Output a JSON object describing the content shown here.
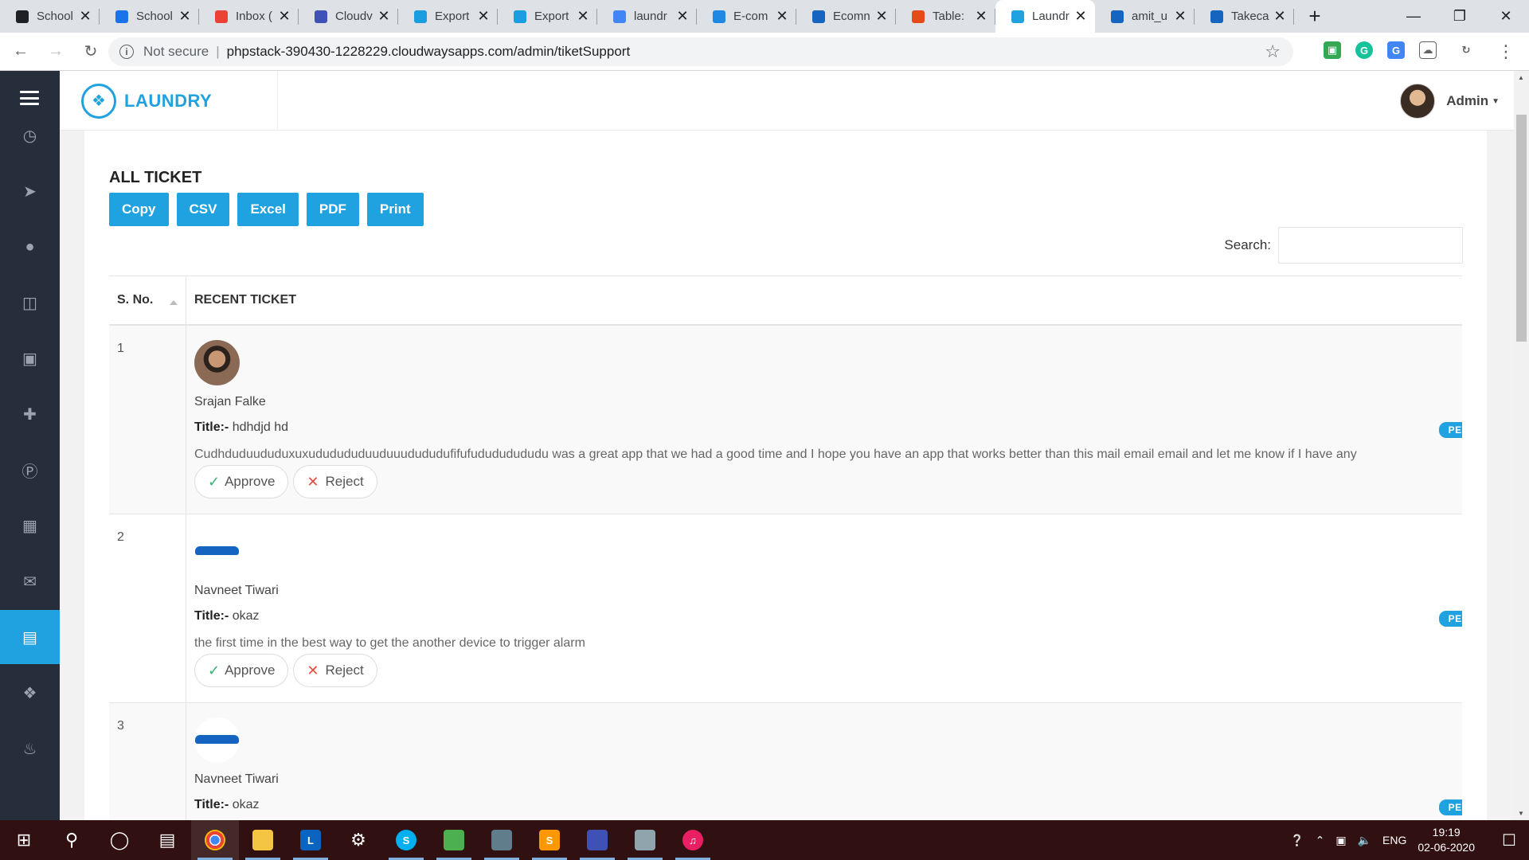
{
  "browser": {
    "tabs": [
      {
        "label": "School",
        "icon_color": "#202124",
        "active": false
      },
      {
        "label": "School",
        "icon_color": "#1a73e8",
        "active": false
      },
      {
        "label": "Inbox (",
        "icon_color": "#ea4335",
        "active": false
      },
      {
        "label": "Cloudv",
        "icon_color": "#3f51b5",
        "active": false
      },
      {
        "label": "Export",
        "icon_color": "#1a9ee0",
        "active": false
      },
      {
        "label": "Export",
        "icon_color": "#1a9ee0",
        "active": false
      },
      {
        "label": "laundr",
        "icon_color": "#4285f4",
        "active": false
      },
      {
        "label": "E-com",
        "icon_color": "#1e88e5",
        "active": false
      },
      {
        "label": "Ecomn",
        "icon_color": "#1565c0",
        "active": false
      },
      {
        "label": "Table:",
        "icon_color": "#e64a19",
        "active": false
      },
      {
        "label": "Laundr",
        "icon_color": "#1fa2df",
        "active": true
      },
      {
        "label": "amit_u",
        "icon_color": "#1565c0",
        "active": false
      },
      {
        "label": "Takeca",
        "icon_color": "#1565c0",
        "active": false
      }
    ],
    "new_tab_symbol": "+",
    "close_symbol": "✕",
    "security_label": "Not secure",
    "url": "phpstack-390430-1228229.cloudwaysapps.com/admin/tiketSupport"
  },
  "app": {
    "brand": "LAUNDRY",
    "user_name": "Admin",
    "accent_color": "#1fa2df",
    "sidebar_icons": [
      "dashboard-icon",
      "send-icon",
      "user-icon",
      "columns-icon",
      "ad-icon",
      "user-plus-icon",
      "parking-icon",
      "gift-icon",
      "ticket-icon",
      "document-icon",
      "cart-icon",
      "bell-icon"
    ],
    "sidebar_active_index": 9
  },
  "page": {
    "title": "ALL TICKET",
    "export_buttons": [
      "Copy",
      "CSV",
      "Excel",
      "PDF",
      "Print"
    ],
    "search_label": "Search:",
    "search_value": "",
    "columns": [
      "S. No.",
      "RECENT TICKET"
    ],
    "title_prefix": "Title:-",
    "approve_label": "Approve",
    "reject_label": "Reject",
    "tickets": [
      {
        "sno": "1",
        "avatar": "photo",
        "name": "Srajan Falke",
        "title": "hdhdjd hd",
        "description": "Cudhduduududuxuxududududuuduuudududufifufudududududu was a great app that we had a good time and I hope you have an app that works better than this mail email email and let me know if I have any",
        "status": "PEND"
      },
      {
        "sno": "2",
        "avatar": "device",
        "name": "Navneet Tiwari",
        "title": "okaz",
        "description": "the first time in the best way to get the another device to trigger alarm",
        "status": "PEND"
      },
      {
        "sno": "3",
        "avatar": "device",
        "name": "Navneet Tiwari",
        "title": "okaz",
        "description": "",
        "status": "PEND"
      }
    ]
  },
  "taskbar": {
    "language": "ENG",
    "time": "19:19",
    "date": "02-06-2020"
  }
}
